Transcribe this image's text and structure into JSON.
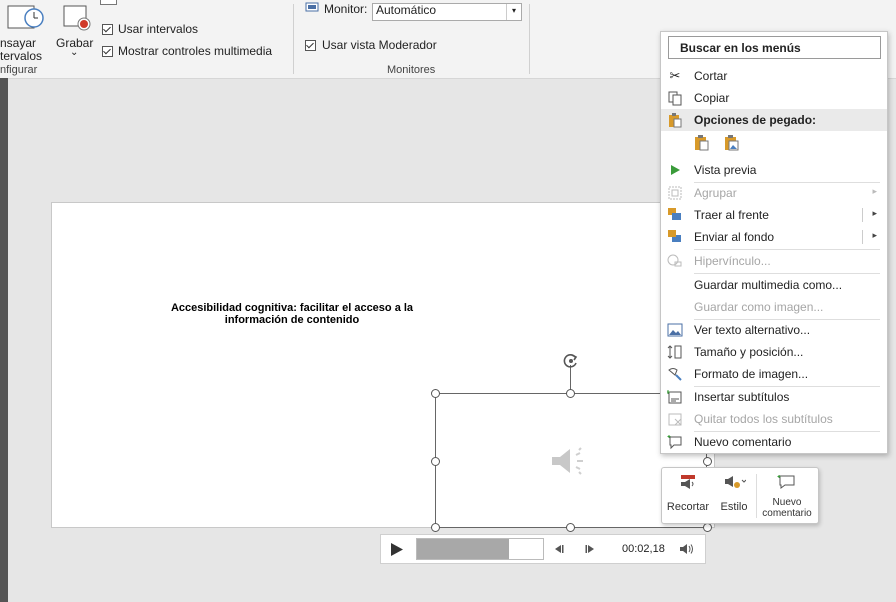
{
  "ribbon": {
    "rehearse_label_1": "nsayar",
    "rehearse_label_2": "tervalos",
    "record_label": "Grabar",
    "record_dropdown": "⌄",
    "use_timings": "Usar intervalos",
    "show_media_controls": "Mostrar controles multimedia",
    "configure_group": "nfigurar",
    "monitor_label": "Monitor:",
    "monitor_value": "Automático",
    "presenter_view": "Usar vista Moderador",
    "monitors_group": "Monitores"
  },
  "slide": {
    "title_line1": "Accesibilidad cognitiva: facilitar el acceso a la",
    "title_line2": "información de contenido"
  },
  "player": {
    "time": "00:02,18",
    "progress": 0.73
  },
  "context_menu": {
    "search": "Buscar en los menús",
    "cut": "Cortar",
    "copy": "Copiar",
    "paste_options": "Opciones de pegado:",
    "preview": "Vista previa",
    "group": "Agrupar",
    "bring_front": "Traer al frente",
    "send_back": "Enviar al fondo",
    "hyperlink": "Hipervínculo...",
    "save_media": "Guardar multimedia como...",
    "save_image": "Guardar como imagen...",
    "alt_text": "Ver texto alternativo...",
    "size_position": "Tamaño y posición...",
    "format_image": "Formato de imagen...",
    "insert_captions": "Insertar subtítulos",
    "remove_captions": "Quitar todos los subtítulos",
    "new_comment": "Nuevo comentario"
  },
  "mini_toolbar": {
    "trim": "Recortar",
    "style": "Estilo",
    "new_comment_1": "Nuevo",
    "new_comment_2": "comentario"
  },
  "colors": {
    "accent": "#c0392b",
    "play": "#3a9b3a",
    "paste": "#d89a2a"
  }
}
